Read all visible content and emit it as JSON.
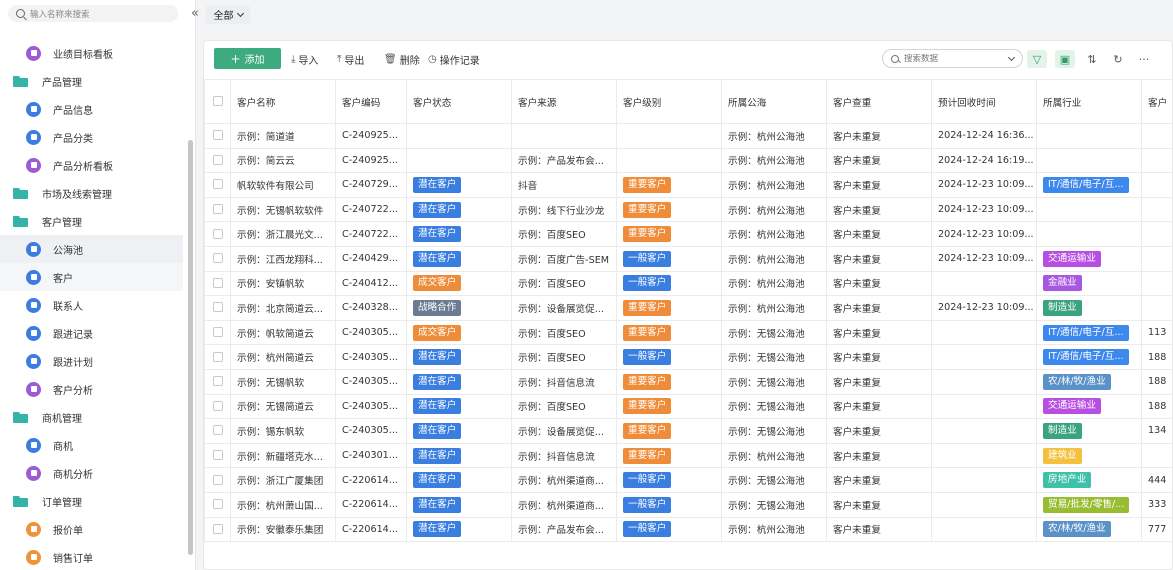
{
  "sidebar": {
    "search_placeholder": "输入名称来搜索",
    "collapse": "«",
    "items": [
      {
        "label": "业绩目标看板",
        "type": "sub",
        "icon": "purple"
      },
      {
        "label": "产品管理",
        "type": "group"
      },
      {
        "label": "产品信息",
        "type": "sub",
        "icon": "blue"
      },
      {
        "label": "产品分类",
        "type": "sub",
        "icon": "blue"
      },
      {
        "label": "产品分析看板",
        "type": "sub",
        "icon": "purple"
      },
      {
        "label": "市场及线索管理",
        "type": "group"
      },
      {
        "label": "客户管理",
        "type": "group"
      },
      {
        "label": "公海池",
        "type": "sub",
        "icon": "blue",
        "state": "active"
      },
      {
        "label": "客户",
        "type": "sub",
        "icon": "blue",
        "state": "hover"
      },
      {
        "label": "联系人",
        "type": "sub",
        "icon": "blue"
      },
      {
        "label": "跟进记录",
        "type": "sub",
        "icon": "blue"
      },
      {
        "label": "跟进计划",
        "type": "sub",
        "icon": "blue"
      },
      {
        "label": "客户分析",
        "type": "sub",
        "icon": "purple"
      },
      {
        "label": "商机管理",
        "type": "group"
      },
      {
        "label": "商机",
        "type": "sub",
        "icon": "blue"
      },
      {
        "label": "商机分析",
        "type": "sub",
        "icon": "purple"
      },
      {
        "label": "订单管理",
        "type": "group"
      },
      {
        "label": "报价单",
        "type": "sub",
        "icon": "orange"
      },
      {
        "label": "销售订单",
        "type": "sub",
        "icon": "orange"
      }
    ]
  },
  "filter": {
    "label": "全部"
  },
  "toolbar": {
    "add": "添加",
    "import": "导入",
    "export": "导出",
    "delete": "删除",
    "log": "操作记录",
    "search_placeholder": "搜索数据"
  },
  "table": {
    "headers": [
      "客户名称",
      "客户编码",
      "客户状态",
      "客户来源",
      "客户级别",
      "所属公海",
      "客户查重",
      "预计回收时间",
      "所属行业",
      "客户"
    ],
    "rows": [
      {
        "name": "示例：简道道",
        "code": "C-240925...",
        "status": "",
        "source": "",
        "level": "",
        "pool": "示例：杭州公海池",
        "dup": "客户未重复",
        "time": "2024-12-24 16:36...",
        "industry": "",
        "extra": ""
      },
      {
        "name": "示例：简云云",
        "code": "C-240925...",
        "status": "",
        "source": "示例：产品发布会...",
        "level": "",
        "pool": "示例：杭州公海池",
        "dup": "客户未重复",
        "time": "2024-12-24 16:19...",
        "industry": "",
        "extra": ""
      },
      {
        "name": "帆软软件有限公司",
        "code": "C-240729...",
        "status": "潜在客户",
        "source": "抖音",
        "level": "重要客户",
        "pool": "示例：杭州公海池",
        "dup": "客户未重复",
        "time": "2024-12-23 10:09...",
        "industry": "IT/通信/电子/互...",
        "extra": ""
      },
      {
        "name": "示例：无锡帆软软件",
        "code": "C-240722...",
        "status": "潜在客户",
        "source": "示例：线下行业沙龙",
        "level": "重要客户",
        "pool": "示例：杭州公海池",
        "dup": "客户未重复",
        "time": "2024-12-23 10:09...",
        "industry": "",
        "extra": ""
      },
      {
        "name": "示例：浙江晨光文...",
        "code": "C-240722...",
        "status": "潜在客户",
        "source": "示例：百度SEO",
        "level": "重要客户",
        "pool": "示例：杭州公海池",
        "dup": "客户未重复",
        "time": "2024-12-23 10:09...",
        "industry": "",
        "extra": ""
      },
      {
        "name": "示例：江西龙翔科...",
        "code": "C-240429...",
        "status": "潜在客户",
        "source": "示例：百度广告-SEM",
        "level": "一般客户",
        "pool": "示例：杭州公海池",
        "dup": "客户未重复",
        "time": "2024-12-23 10:09...",
        "industry": "交通运输业",
        "extra": ""
      },
      {
        "name": "示例：安镇帆软",
        "code": "C-240412...",
        "status": "成交客户",
        "source": "示例：百度SEO",
        "level": "一般客户",
        "pool": "示例：杭州公海池",
        "dup": "客户未重复",
        "time": "",
        "industry": "金融业",
        "extra": ""
      },
      {
        "name": "示例：北京简道云...",
        "code": "C-240328...",
        "status": "战略合作",
        "source": "示例：设备展览促...",
        "level": "重要客户",
        "pool": "示例：杭州公海池",
        "dup": "客户未重复",
        "time": "2024-12-23 10:09...",
        "industry": "制造业",
        "extra": ""
      },
      {
        "name": "示例：帆软简道云",
        "code": "C-240305...",
        "status": "成交客户",
        "source": "示例：百度SEO",
        "level": "重要客户",
        "pool": "示例：无锡公海池",
        "dup": "客户未重复",
        "time": "",
        "industry": "IT/通信/电子/互...",
        "extra": "113"
      },
      {
        "name": "示例：杭州简道云",
        "code": "C-240305...",
        "status": "潜在客户",
        "source": "示例：百度SEO",
        "level": "一般客户",
        "pool": "示例：无锡公海池",
        "dup": "客户未重复",
        "time": "",
        "industry": "IT/通信/电子/互...",
        "extra": "188"
      },
      {
        "name": "示例：无锡帆软",
        "code": "C-240305...",
        "status": "潜在客户",
        "source": "示例：抖音信息流",
        "level": "重要客户",
        "pool": "示例：无锡公海池",
        "dup": "客户未重复",
        "time": "",
        "industry": "农/林/牧/渔业",
        "extra": "188"
      },
      {
        "name": "示例：无锡简道云",
        "code": "C-240305...",
        "status": "潜在客户",
        "source": "示例：百度SEO",
        "level": "重要客户",
        "pool": "示例：无锡公海池",
        "dup": "客户未重复",
        "time": "",
        "industry": "交通运输业",
        "extra": "188"
      },
      {
        "name": "示例：锡东帆软",
        "code": "C-240305...",
        "status": "潜在客户",
        "source": "示例：设备展览促...",
        "level": "重要客户",
        "pool": "示例：无锡公海池",
        "dup": "客户未重复",
        "time": "",
        "industry": "制造业",
        "extra": "134"
      },
      {
        "name": "示例：新疆塔克水...",
        "code": "C-240301...",
        "status": "潜在客户",
        "source": "示例：抖音信息流",
        "level": "重要客户",
        "pool": "示例：杭州公海池",
        "dup": "客户未重复",
        "time": "",
        "industry": "建筑业",
        "extra": ""
      },
      {
        "name": "示例：浙江广厦集团",
        "code": "C-220614...",
        "status": "潜在客户",
        "source": "示例：杭州渠道商...",
        "level": "一般客户",
        "pool": "示例：无锡公海池",
        "dup": "客户未重复",
        "time": "",
        "industry": "房地产业",
        "extra": "444"
      },
      {
        "name": "示例：杭州萧山国...",
        "code": "C-220614...",
        "status": "潜在客户",
        "source": "示例：杭州渠道商...",
        "level": "一般客户",
        "pool": "示例：无锡公海池",
        "dup": "客户未重复",
        "time": "",
        "industry": "贸易/批发/零售/...",
        "extra": "333"
      },
      {
        "name": "示例：安徽泰乐集团",
        "code": "C-220614...",
        "status": "潜在客户",
        "source": "示例：产品发布会...",
        "level": "一般客户",
        "pool": "示例：杭州公海池",
        "dup": "客户未重复",
        "time": "",
        "industry": "农/林/牧/渔业",
        "extra": "777"
      }
    ]
  },
  "colors": {
    "潜在客户": "#3a7ee0",
    "成交客户": "#ef8c3a",
    "战略合作": "#6b7c93",
    "重要客户": "#ef8c3a",
    "一般客户": "#3a7ee0",
    "IT/通信/电子/互...": "#3d88ec",
    "交通运输业": "#b84fe0",
    "金融业": "#a857e0",
    "制造业": "#3aa380",
    "农/林/牧/渔业": "#5a92c8",
    "建筑业": "#f3c040",
    "房地产业": "#40c0a8",
    "贸易/批发/零售/...": "#99bd32"
  }
}
